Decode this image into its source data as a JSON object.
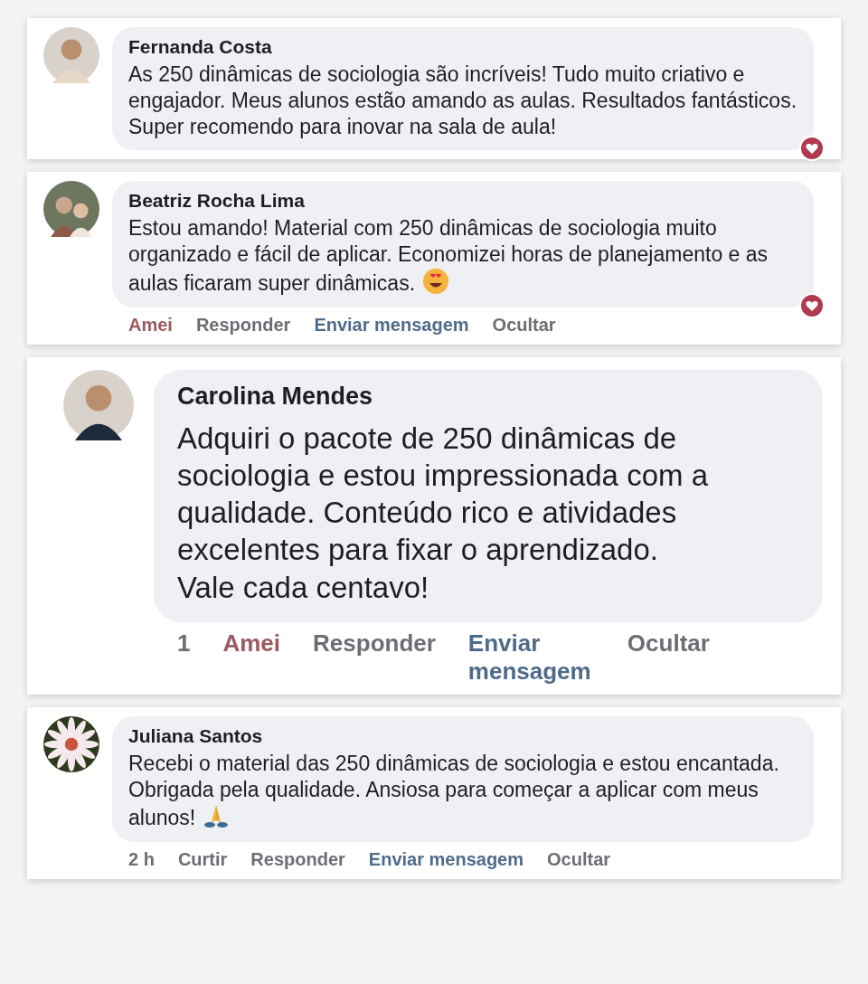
{
  "comments": [
    {
      "kind": "small",
      "author": "Fernanda Costa",
      "avatar": {
        "kind": "person"
      },
      "text": "As 250 dinâmicas de sociologia são incríveis! Tudo muito criativo e engajador. Meus alunos estão amando as aulas. Resultados fantásticos.\nSuper recomendo para inovar na sala de aula!",
      "reaction": {
        "kind": "heart"
      }
    },
    {
      "kind": "small",
      "author": "Beatriz Rocha Lima",
      "avatar": {
        "kind": "people"
      },
      "text": "Estou amando! Material com 250 dinâmicas de sociologia muito organizado e fácil de aplicar. Economizei horas de planejamento e as aulas ficaram super dinâmicas.",
      "emoji": {
        "kind": "heart-eyes"
      },
      "reaction": {
        "kind": "heart"
      },
      "actions": [
        {
          "label": "Amei",
          "kind": "loved"
        },
        {
          "label": "Responder",
          "kind": "plain"
        },
        {
          "label": "Enviar mensagem",
          "kind": "message"
        },
        {
          "label": "Ocultar",
          "kind": "plain"
        }
      ]
    },
    {
      "kind": "large",
      "author": "Carolina Mendes",
      "avatar": {
        "kind": "person"
      },
      "text": "Adquiri o pacote de 250 dinâmicas de sociologia e estou impressionada com a qualidade. Conteúdo rico e atividades excelentes para fixar o aprendizado.\nVale cada centavo!",
      "actions": [
        {
          "label": "1",
          "kind": "plain"
        },
        {
          "label": "Amei",
          "kind": "loved"
        },
        {
          "label": "Responder",
          "kind": "plain"
        },
        {
          "label": "Enviar mensagem",
          "kind": "message"
        },
        {
          "label": "Ocultar",
          "kind": "plain"
        }
      ]
    },
    {
      "kind": "small",
      "author": "Juliana Santos",
      "avatar": {
        "kind": "flower"
      },
      "text": "Recebi o material das 250 dinâmicas de sociologia e estou encantada. Obrigada pela qualidade. Ansiosa para começar a aplicar com meus alunos!",
      "emoji": {
        "kind": "pray"
      },
      "actions": [
        {
          "label": "2 h",
          "kind": "plain"
        },
        {
          "label": "Curtir",
          "kind": "plain"
        },
        {
          "label": "Responder",
          "kind": "plain"
        },
        {
          "label": "Enviar mensagem",
          "kind": "message"
        },
        {
          "label": "Ocultar",
          "kind": "plain"
        }
      ]
    }
  ]
}
